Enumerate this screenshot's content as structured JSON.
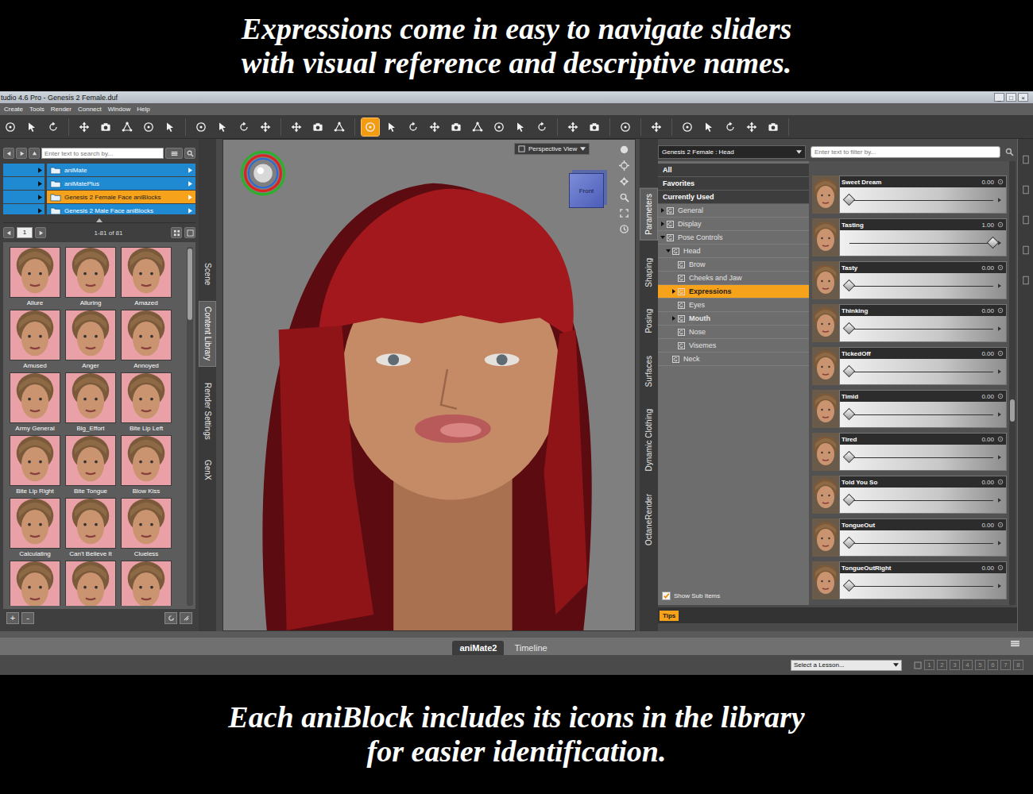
{
  "banner_top": [
    "Expressions come in easy to navigate sliders",
    "with visual reference and descriptive names."
  ],
  "banner_bottom": [
    "Each aniBlock includes its icons in the library",
    "for easier identification."
  ],
  "window": {
    "title": "tudio 4.6 Pro - Genesis 2 Female.duf",
    "controls": [
      "_",
      "□",
      "×"
    ]
  },
  "menu": [
    "Create",
    "Tools",
    "Render",
    "Connect",
    "Window",
    "Help"
  ],
  "toolbar": [
    [
      {
        "selected": false
      },
      {
        "selected": false
      },
      {
        "selected": false
      }
    ],
    [
      {
        "selected": false
      },
      {
        "selected": false
      },
      {
        "selected": false
      },
      {
        "selected": false
      },
      {
        "selected": false
      }
    ],
    [
      {
        "selected": false
      },
      {
        "selected": false
      },
      {
        "selected": false
      },
      {
        "selected": false
      }
    ],
    [
      {
        "selected": false
      },
      {
        "selected": false
      },
      {
        "selected": false
      }
    ],
    [
      {
        "selected": true
      },
      {
        "selected": false
      },
      {
        "selected": false
      },
      {
        "selected": false
      },
      {
        "selected": false
      },
      {
        "selected": false
      },
      {
        "selected": false
      },
      {
        "selected": false
      },
      {
        "selected": false
      }
    ],
    [
      {
        "selected": false
      },
      {
        "selected": false
      }
    ],
    [
      {
        "selected": false
      }
    ],
    [
      {
        "selected": false
      }
    ],
    [
      {
        "selected": false
      },
      {
        "selected": false
      },
      {
        "selected": false
      },
      {
        "selected": false
      },
      {
        "selected": false
      }
    ]
  ],
  "content_library": {
    "search_placeholder": "Enter text to search by...",
    "folders": [
      {
        "label": "aniMate",
        "selected": false
      },
      {
        "label": "aniMatePlus",
        "selected": false
      },
      {
        "label": "Genesis 2 Female Face aniBlocks",
        "selected": true
      },
      {
        "label": "Genesis 2 Male Face aniBlocks",
        "selected": false
      }
    ],
    "page": "1",
    "count": "1-81 of 81",
    "items": [
      "Allure",
      "Alluring",
      "Amazed",
      "Amused",
      "Anger",
      "Annoyed",
      "Army General",
      "Big_Effort",
      "Bite Lip Left",
      "Bite Lip Right",
      "Bite Tongue",
      "Blow Kiss",
      "Calculating",
      "Can't Believe It",
      "Clueless"
    ],
    "buttons": [
      "+",
      "-"
    ]
  },
  "left_tabs": [
    {
      "label": "Scene",
      "selected": false
    },
    {
      "label": "Content Library",
      "selected": true
    },
    {
      "label": "Render Settings",
      "selected": false
    },
    {
      "label": "GenX",
      "selected": false
    }
  ],
  "viewport": {
    "view": "Perspective View",
    "cube_label": "Front"
  },
  "right_tabs": [
    {
      "label": "Parameters",
      "selected": true
    },
    {
      "label": "Shaping",
      "selected": false
    },
    {
      "label": "Posing",
      "selected": false
    },
    {
      "label": "Surfaces",
      "selected": false
    },
    {
      "label": "Dynamic Clothing",
      "selected": false
    },
    {
      "label": "OctaneRender",
      "selected": false
    }
  ],
  "parameters": {
    "node": "Genesis 2 Female : Head",
    "filter_placeholder": "Enter text to filter by...",
    "tree": [
      {
        "label": "All",
        "kind": "header",
        "depth": 0,
        "expandable": false,
        "expanded": false,
        "selected": false,
        "bold": true
      },
      {
        "label": "Favorites",
        "kind": "header",
        "depth": 0,
        "expandable": false,
        "expanded": false,
        "selected": false,
        "bold": true
      },
      {
        "label": "Currently Used",
        "kind": "header",
        "depth": 0,
        "expandable": false,
        "expanded": false,
        "selected": false,
        "bold": true
      },
      {
        "label": "General",
        "kind": "node",
        "depth": 0,
        "expandable": true,
        "expanded": false,
        "selected": false,
        "bold": false
      },
      {
        "label": "Display",
        "kind": "node",
        "depth": 0,
        "expandable": true,
        "expanded": false,
        "selected": false,
        "bold": false
      },
      {
        "label": "Pose Controls",
        "kind": "node",
        "depth": 0,
        "expandable": true,
        "expanded": true,
        "selected": false,
        "bold": false
      },
      {
        "label": "Head",
        "kind": "node",
        "depth": 1,
        "expandable": true,
        "expanded": true,
        "selected": false,
        "bold": false
      },
      {
        "label": "Brow",
        "kind": "node",
        "depth": 2,
        "expandable": false,
        "expanded": false,
        "selected": false,
        "bold": false
      },
      {
        "label": "Cheeks and Jaw",
        "kind": "node",
        "depth": 2,
        "expandable": false,
        "expanded": false,
        "selected": false,
        "bold": false
      },
      {
        "label": "Expressions",
        "kind": "node",
        "depth": 2,
        "expandable": true,
        "expanded": false,
        "selected": true,
        "bold": true
      },
      {
        "label": "Eyes",
        "kind": "node",
        "depth": 2,
        "expandable": false,
        "expanded": false,
        "selected": false,
        "bold": false
      },
      {
        "label": "Mouth",
        "kind": "node",
        "depth": 2,
        "expandable": true,
        "expanded": false,
        "selected": false,
        "bold": true
      },
      {
        "label": "Nose",
        "kind": "node",
        "depth": 2,
        "expandable": false,
        "expanded": false,
        "selected": false,
        "bold": false
      },
      {
        "label": "Visemes",
        "kind": "node",
        "depth": 2,
        "expandable": false,
        "expanded": false,
        "selected": false,
        "bold": false
      },
      {
        "label": "Neck",
        "kind": "node",
        "depth": 1,
        "expandable": false,
        "expanded": false,
        "selected": false,
        "bold": false
      }
    ],
    "show_sub_items": {
      "label": "Show Sub Items",
      "checked": true
    },
    "sliders": [
      {
        "name": "Sweet Dream",
        "value": "0.00",
        "level": 0
      },
      {
        "name": "Tasting",
        "value": "1.00",
        "level": 1
      },
      {
        "name": "Tasty",
        "value": "0.00",
        "level": 0
      },
      {
        "name": "Thinking",
        "value": "0.00",
        "level": 0
      },
      {
        "name": "TickedOff",
        "value": "0.00",
        "level": 0
      },
      {
        "name": "Timid",
        "value": "0.00",
        "level": 0
      },
      {
        "name": "Tired",
        "value": "0.00",
        "level": 0
      },
      {
        "name": "Told You So",
        "value": "0.00",
        "level": 0
      },
      {
        "name": "TongueOut",
        "value": "0.00",
        "level": 0
      },
      {
        "name": "TongueOutRight",
        "value": "0.00",
        "level": 0
      }
    ],
    "tips": "Tips"
  },
  "pane_tabs": [
    {
      "label": "aniMate2",
      "selected": true
    },
    {
      "label": "Timeline",
      "selected": false
    }
  ],
  "lessons": {
    "placeholder": "Select a Lesson...",
    "pages": [
      "1",
      "2",
      "3",
      "4",
      "5",
      "6",
      "7",
      "8"
    ]
  }
}
